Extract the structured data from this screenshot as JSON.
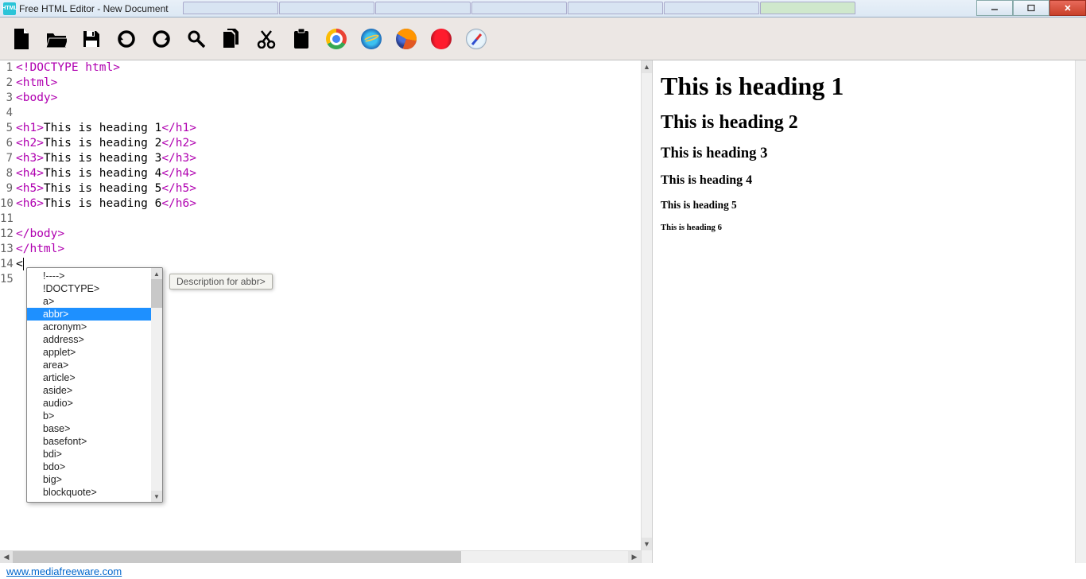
{
  "window": {
    "title": "Free HTML Editor - New Document",
    "app_icon_text": "HTML"
  },
  "code_lines": [
    {
      "n": 1,
      "parts": [
        {
          "c": "doctype",
          "t": "<!DOCTYPE html>"
        }
      ]
    },
    {
      "n": 2,
      "parts": [
        {
          "c": "tag",
          "t": "<html>"
        }
      ]
    },
    {
      "n": 3,
      "parts": [
        {
          "c": "tag",
          "t": "<body>"
        }
      ]
    },
    {
      "n": 4,
      "parts": []
    },
    {
      "n": 5,
      "parts": [
        {
          "c": "tag",
          "t": "<h1>"
        },
        {
          "c": "txt",
          "t": "This is heading 1"
        },
        {
          "c": "tag",
          "t": "</h1>"
        }
      ]
    },
    {
      "n": 6,
      "parts": [
        {
          "c": "tag",
          "t": "<h2>"
        },
        {
          "c": "txt",
          "t": "This is heading 2"
        },
        {
          "c": "tag",
          "t": "</h2>"
        }
      ]
    },
    {
      "n": 7,
      "parts": [
        {
          "c": "tag",
          "t": "<h3>"
        },
        {
          "c": "txt",
          "t": "This is heading 3"
        },
        {
          "c": "tag",
          "t": "</h3>"
        }
      ]
    },
    {
      "n": 8,
      "parts": [
        {
          "c": "tag",
          "t": "<h4>"
        },
        {
          "c": "txt",
          "t": "This is heading 4"
        },
        {
          "c": "tag",
          "t": "</h4>"
        }
      ]
    },
    {
      "n": 9,
      "parts": [
        {
          "c": "tag",
          "t": "<h5>"
        },
        {
          "c": "txt",
          "t": "This is heading 5"
        },
        {
          "c": "tag",
          "t": "</h5>"
        }
      ]
    },
    {
      "n": 10,
      "parts": [
        {
          "c": "tag",
          "t": "<h6>"
        },
        {
          "c": "txt",
          "t": "This is heading 6"
        },
        {
          "c": "tag",
          "t": "</h6>"
        }
      ]
    },
    {
      "n": 11,
      "parts": []
    },
    {
      "n": 12,
      "parts": [
        {
          "c": "tag",
          "t": "</body>"
        }
      ]
    },
    {
      "n": 13,
      "parts": [
        {
          "c": "tag",
          "t": "</html>"
        }
      ]
    },
    {
      "n": 14,
      "parts": [
        {
          "c": "txt",
          "t": "<"
        }
      ],
      "caret": true
    },
    {
      "n": 15,
      "parts": []
    }
  ],
  "autocomplete": {
    "selected_index": 3,
    "items": [
      "!---->",
      "!DOCTYPE>",
      "a>",
      "abbr>",
      "acronym>",
      "address>",
      "applet>",
      "area>",
      "article>",
      "aside>",
      "audio>",
      "b>",
      "base>",
      "basefont>",
      "bdi>",
      "bdo>",
      "big>",
      "blockquote>"
    ]
  },
  "tooltip": {
    "text": "Description for abbr>"
  },
  "preview": {
    "h1": "This is heading 1",
    "h2": "This is heading 2",
    "h3": "This is heading 3",
    "h4": "This is heading 4",
    "h5": "This is heading 5",
    "h6": "This is heading 6"
  },
  "footer": {
    "link": "www.mediafreeware.com"
  }
}
